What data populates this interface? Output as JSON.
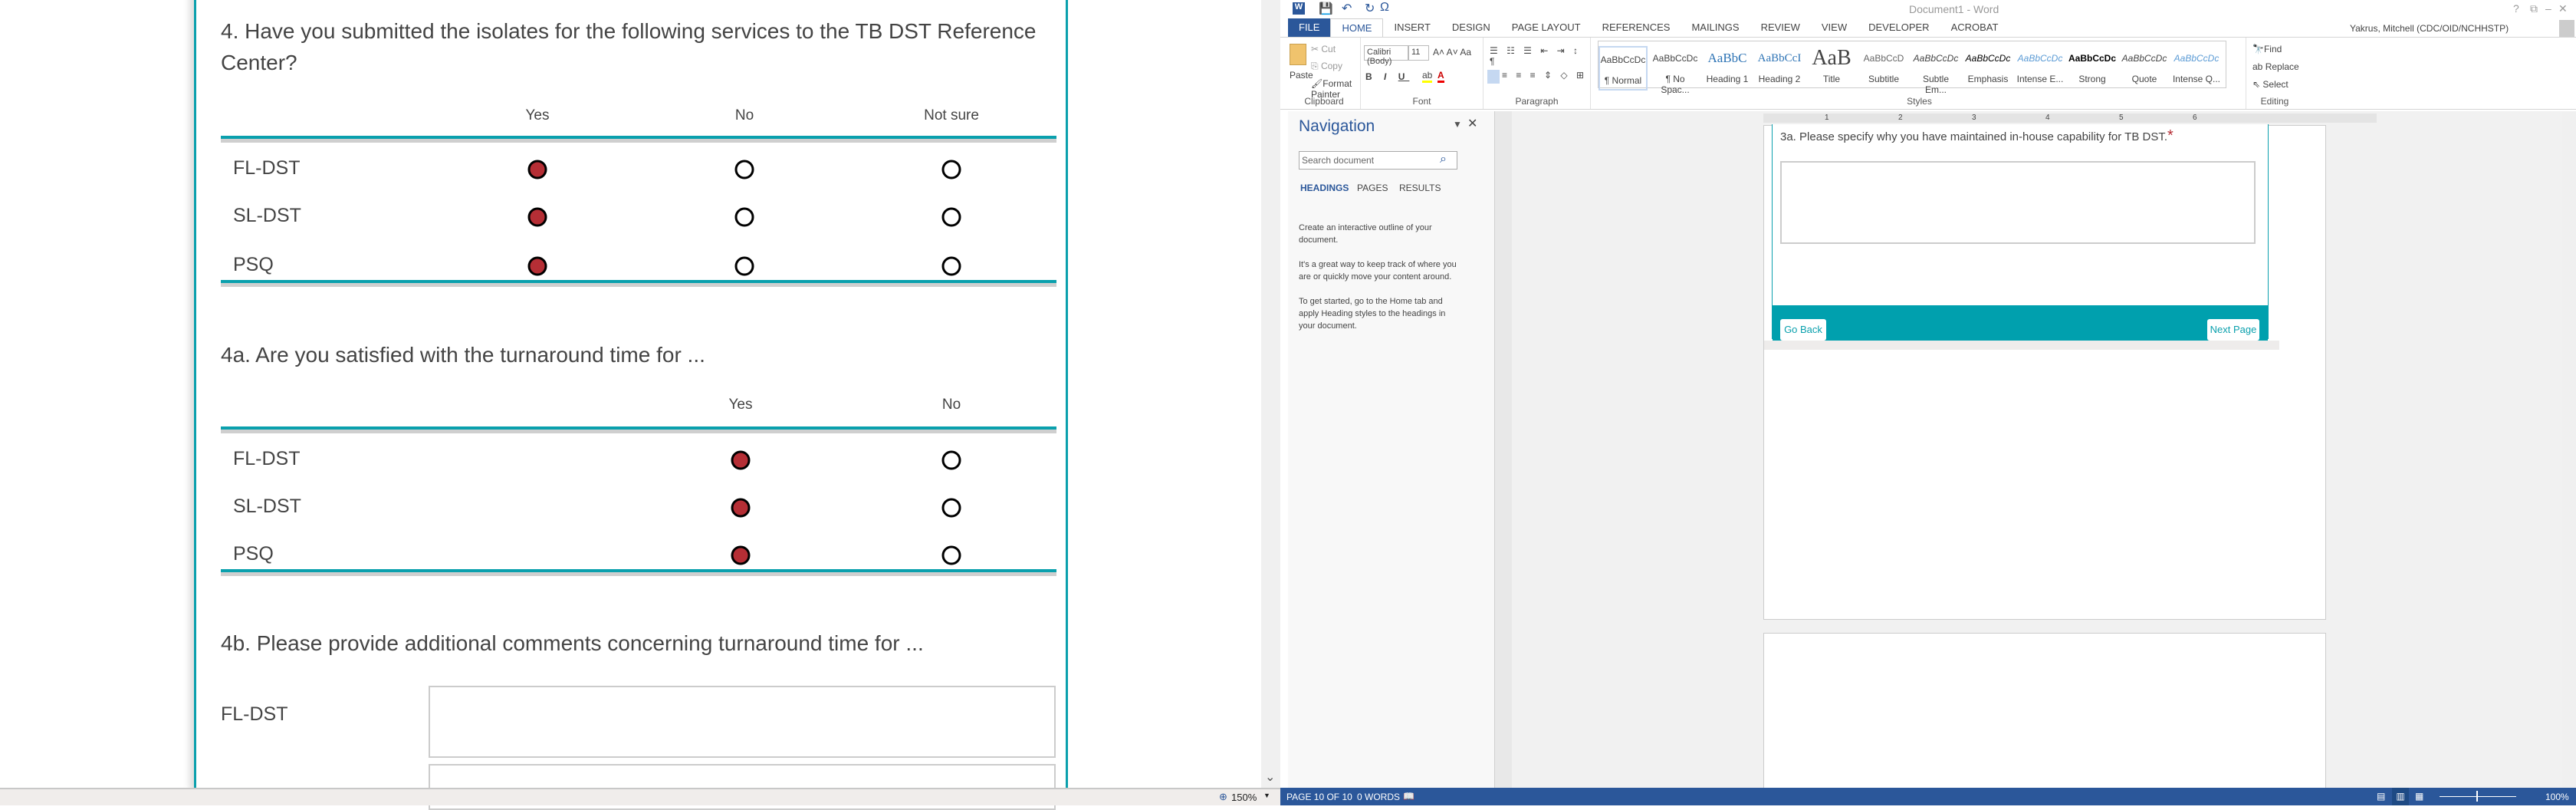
{
  "left": {
    "q4": {
      "text": "4. Have you submitted the isolates for the following services to the TB DST Reference Center?",
      "columns": [
        "Yes",
        "No",
        "Not sure"
      ],
      "rows": [
        {
          "label": "FL-DST",
          "selected": 0
        },
        {
          "label": "SL-DST",
          "selected": 0
        },
        {
          "label": "PSQ",
          "selected": 0
        }
      ]
    },
    "q4a": {
      "text": "4a. Are you satisfied with the turnaround time for ...",
      "columns": [
        "Yes",
        "No"
      ],
      "rows": [
        {
          "label": "FL-DST",
          "selected": 0
        },
        {
          "label": "SL-DST",
          "selected": 0
        },
        {
          "label": "PSQ",
          "selected": 0
        }
      ]
    },
    "q4b": {
      "text": "4b. Please provide additional comments concerning turnaround time for ...",
      "rows": [
        {
          "label": "FL-DST",
          "value": ""
        }
      ]
    },
    "status": {
      "zoom": "150%"
    }
  },
  "word": {
    "title": "Document1 - Word",
    "window_controls": [
      "?",
      "⧉",
      "–",
      "🗗",
      "✕"
    ],
    "user": "Yakrus, Mitchell (CDC/OID/NCHHSTP)",
    "tabs": [
      "FILE",
      "HOME",
      "INSERT",
      "DESIGN",
      "PAGE LAYOUT",
      "REFERENCES",
      "MAILINGS",
      "REVIEW",
      "VIEW",
      "DEVELOPER",
      "ACROBAT"
    ],
    "clipboard": {
      "paste": "Paste",
      "cut": "Cut",
      "copy": "Copy",
      "format_painter": "Format Painter",
      "label": "Clipboard"
    },
    "font": {
      "name": "Calibri (Body)",
      "size": "11",
      "label": "Font"
    },
    "paragraph": {
      "label": "Paragraph"
    },
    "styles": {
      "label": "Styles",
      "items": [
        {
          "preview": "AaBbCcDc",
          "name": "¶ Normal"
        },
        {
          "preview": "AaBbCcDc",
          "name": "¶ No Spac..."
        },
        {
          "preview": "AaBbC",
          "name": "Heading 1"
        },
        {
          "preview": "AaBbCcI",
          "name": "Heading 2"
        },
        {
          "preview": "AaB",
          "name": "Title"
        },
        {
          "preview": "AaBbCcD",
          "name": "Subtitle"
        },
        {
          "preview": "AaBbCcDc",
          "name": "Subtle Em..."
        },
        {
          "preview": "AaBbCcDc",
          "name": "Emphasis"
        },
        {
          "preview": "AaBbCcDc",
          "name": "Intense E..."
        },
        {
          "preview": "AaBbCcDc",
          "name": "Strong"
        },
        {
          "preview": "AaBbCcDc",
          "name": "Quote"
        },
        {
          "preview": "AaBbCcDc",
          "name": "Intense Q..."
        }
      ]
    },
    "editing": {
      "find": "Find",
      "replace": "Replace",
      "select": "Select",
      "label": "Editing"
    },
    "nav": {
      "title": "Navigation",
      "search_placeholder": "Search document",
      "tabs": [
        "HEADINGS",
        "PAGES",
        "RESULTS"
      ],
      "p1": "Create an interactive outline of your document.",
      "p2": "It's a great way to keep track of where you are or quickly move your content around.",
      "p3": "To get started, go to the Home tab and apply Heading styles to the headings in your document."
    },
    "ruler": [
      "1",
      "2",
      "3",
      "4",
      "5",
      "6"
    ],
    "doc": {
      "question": "3a. Please specify why you have maintained in-house capability for TB DST.",
      "required": "*",
      "answer": "",
      "back": "Go Back",
      "next": "Next Page"
    },
    "status": {
      "page": "PAGE 10 OF 10",
      "words": "0 WORDS",
      "zoom": "100%"
    }
  },
  "colors": {
    "teal": "#0aa0ad",
    "selected": "#b52e35",
    "word_blue": "#2b579a"
  }
}
